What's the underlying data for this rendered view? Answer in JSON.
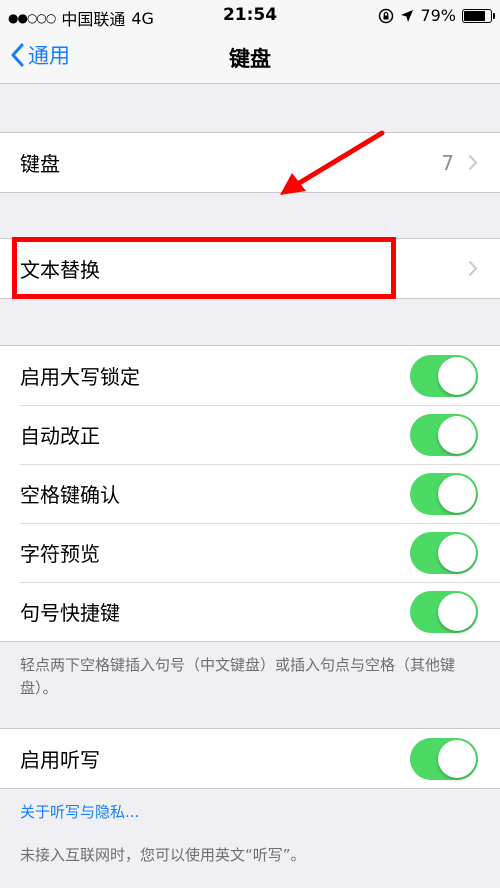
{
  "status_bar": {
    "signal_dots": "●●○○○",
    "carrier": "中国联通",
    "network": "4G",
    "time": "21:54",
    "battery_percent": "79%",
    "battery_level": 0.79,
    "icons": [
      "orientation-lock-icon",
      "location-arrow-icon",
      "battery-icon"
    ]
  },
  "nav": {
    "back_label": "通用",
    "title": "键盘"
  },
  "keyboards": {
    "label": "键盘",
    "count": "7"
  },
  "text_replacement": {
    "label": "文本替换"
  },
  "toggles": [
    {
      "label": "启用大写锁定",
      "on": true
    },
    {
      "label": "自动改正",
      "on": true
    },
    {
      "label": "空格键确认",
      "on": true
    },
    {
      "label": "字符预览",
      "on": true
    },
    {
      "label": "句号快捷键",
      "on": true
    }
  ],
  "period_shortcut_note": "轻点两下空格键插入句号（中文键盘）或插入句点与空格（其他键盘）。",
  "dictation": {
    "label": "启用听写",
    "on": true,
    "privacy_link": "关于听写与隐私...",
    "note": "未接入互联网时，您可以使用英文“听写”。"
  },
  "colors": {
    "accent": "#157efb",
    "toggle_on": "#4cd964",
    "annotation": "#ff0000",
    "background": "#efeff4"
  }
}
